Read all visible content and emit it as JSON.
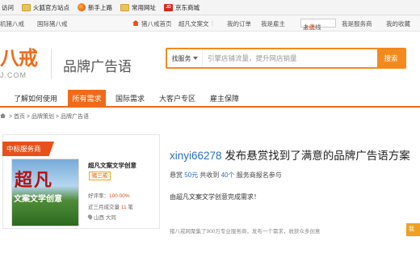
{
  "bookmarks": [
    {
      "label": "访问",
      "icon": "history-icon"
    },
    {
      "label": "火狐官方站点",
      "icon": "folder-icon"
    },
    {
      "label": "新手上路",
      "icon": "firefox-icon"
    },
    {
      "label": "常用网址",
      "icon": "folder-icon"
    },
    {
      "label": "京东商城",
      "icon": "jd-icon"
    }
  ],
  "topbar": {
    "site": "机猪八戒",
    "intl": "国际猪八戒",
    "home": "猪八戒首页",
    "wenan": "超凡文案文",
    "orders": "我的订单",
    "employer": "我是雇主",
    "login": "未上线",
    "login_up": "上线",
    "provider": "我是服务商",
    "fav": "我的收藏"
  },
  "logo": {
    "mark": "八戒",
    "domain": "J.COM"
  },
  "brand_title": "品牌广告语",
  "search": {
    "select": "找服务",
    "placeholder": "引擎店铺流量，提升网店销量",
    "button": "搜索"
  },
  "nav": {
    "items": [
      "了解如何使用",
      "所有需求",
      "国际需求",
      "大客户专区",
      "雇主保障"
    ],
    "active": "所有需求"
  },
  "breadcrumb": [
    "首页",
    "品牌策划",
    "品牌广告语"
  ],
  "card": {
    "badge": "中标服务商",
    "thumb_big": "超凡",
    "thumb_small": "文案文学创意",
    "shop_name": "超凡文案文学创意",
    "tier": "猪三戒",
    "rating_label": "好评率：",
    "rating_value": "100.00%",
    "deals_label": "近三月成交量",
    "deals_value": "11",
    "deals_unit": "笔",
    "location": "山西 大同"
  },
  "job": {
    "username": "xinyi66278",
    "title_rest": "发布悬赏找到了满意的品牌广告语方案",
    "bounty_label": "悬赏",
    "bounty": "50元",
    "total_label": "共收到",
    "count": "40个",
    "count_rest": "服务商报名参与",
    "completed_text": "由超凡文案文学创意完成需求！",
    "footer": "猪八戒网聚集了900万专业服务商，发布一个需求，收获众多创意",
    "button": "我"
  }
}
